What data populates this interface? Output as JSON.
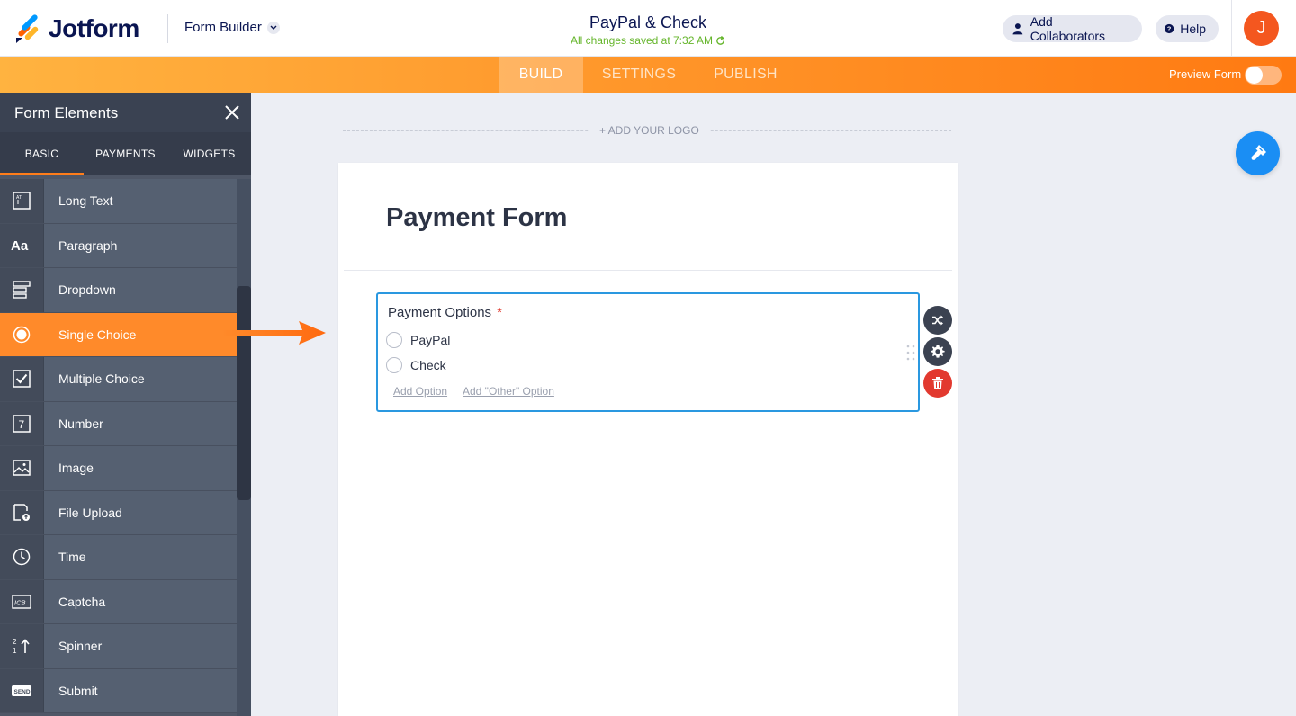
{
  "header": {
    "brand": "Jotform",
    "builder_label": "Form Builder",
    "form_title": "PayPal & Check",
    "saved_status": "All changes saved at 7:32 AM",
    "collaborators_label": "Add Collaborators",
    "help_label": "Help",
    "avatar_initial": "J"
  },
  "nav": {
    "tabs": [
      "BUILD",
      "SETTINGS",
      "PUBLISH"
    ],
    "active_tab": "BUILD",
    "preview_label": "Preview Form",
    "preview_enabled": false
  },
  "sidebar": {
    "title": "Form Elements",
    "tabs": [
      "BASIC",
      "PAYMENTS",
      "WIDGETS"
    ],
    "active_tab": "BASIC",
    "items": [
      {
        "label": "Long Text",
        "icon": "long-text-icon"
      },
      {
        "label": "Paragraph",
        "icon": "paragraph-icon"
      },
      {
        "label": "Dropdown",
        "icon": "dropdown-icon"
      },
      {
        "label": "Single Choice",
        "icon": "radio-icon"
      },
      {
        "label": "Multiple Choice",
        "icon": "checkbox-icon"
      },
      {
        "label": "Number",
        "icon": "number-icon"
      },
      {
        "label": "Image",
        "icon": "image-icon"
      },
      {
        "label": "File Upload",
        "icon": "file-upload-icon"
      },
      {
        "label": "Time",
        "icon": "clock-icon"
      },
      {
        "label": "Captcha",
        "icon": "captcha-icon"
      },
      {
        "label": "Spinner",
        "icon": "spinner-icon"
      },
      {
        "label": "Submit",
        "icon": "send-icon"
      }
    ],
    "selected_item": "Single Choice"
  },
  "canvas": {
    "add_logo": "+ ADD YOUR LOGO",
    "heading": "Payment Form",
    "question": {
      "label": "Payment Options",
      "required_mark": "*",
      "options": [
        "PayPal",
        "Check"
      ],
      "add_option": "Add Option",
      "add_other": "Add \"Other\" Option"
    }
  },
  "colors": {
    "brand_orange": "#ff7a12",
    "sidebar_bg": "#4f5767",
    "selected_blue": "#2a98e0",
    "delete_red": "#e2392f",
    "saved_green": "#64b52a"
  }
}
